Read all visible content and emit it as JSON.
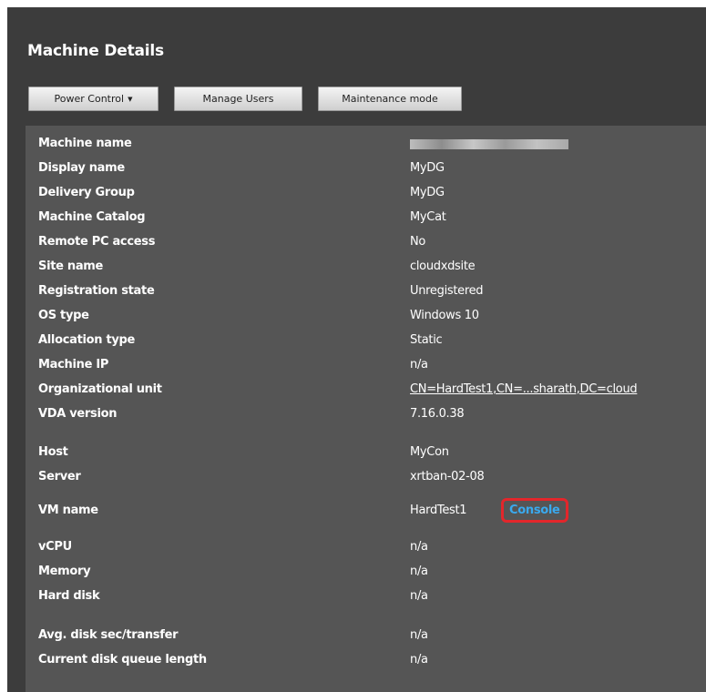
{
  "header": {
    "title": "Machine Details"
  },
  "toolbar": {
    "power_control": "Power Control",
    "manage_users": "Manage Users",
    "maintenance_mode": "Maintenance mode"
  },
  "details": [
    {
      "label": "Machine name",
      "value": ""
    },
    {
      "label": "Display name",
      "value": "MyDG"
    },
    {
      "label": "Delivery Group",
      "value": "MyDG"
    },
    {
      "label": "Machine Catalog",
      "value": "MyCat"
    },
    {
      "label": "Remote PC access",
      "value": "No"
    },
    {
      "label": "Site name",
      "value": "cloudxdsite"
    },
    {
      "label": "Registration state",
      "value": "Unregistered"
    },
    {
      "label": "OS type",
      "value": "Windows 10"
    },
    {
      "label": "Allocation type",
      "value": "Static"
    },
    {
      "label": "Machine IP",
      "value": "n/a"
    },
    {
      "label": "Organizational unit",
      "value": "CN=HardTest1,CN=...sharath,DC=cloud"
    },
    {
      "label": "VDA version",
      "value": "7.16.0.38"
    },
    {
      "label": "Host",
      "value": "MyCon"
    },
    {
      "label": "Server",
      "value": "xrtban-02-08"
    },
    {
      "label": "VM name",
      "value": "HardTest1",
      "link": "Console"
    },
    {
      "label": "vCPU",
      "value": "n/a"
    },
    {
      "label": "Memory",
      "value": "n/a"
    },
    {
      "label": "Hard disk",
      "value": "n/a"
    },
    {
      "label": "Avg. disk sec/transfer",
      "value": "n/a"
    },
    {
      "label": "Current disk queue length",
      "value": "n/a"
    }
  ],
  "colors": {
    "frame_bg": "#3c3c3c",
    "panel_bg": "#555555",
    "link": "#3aa9ee",
    "highlight": "#e3262b"
  }
}
